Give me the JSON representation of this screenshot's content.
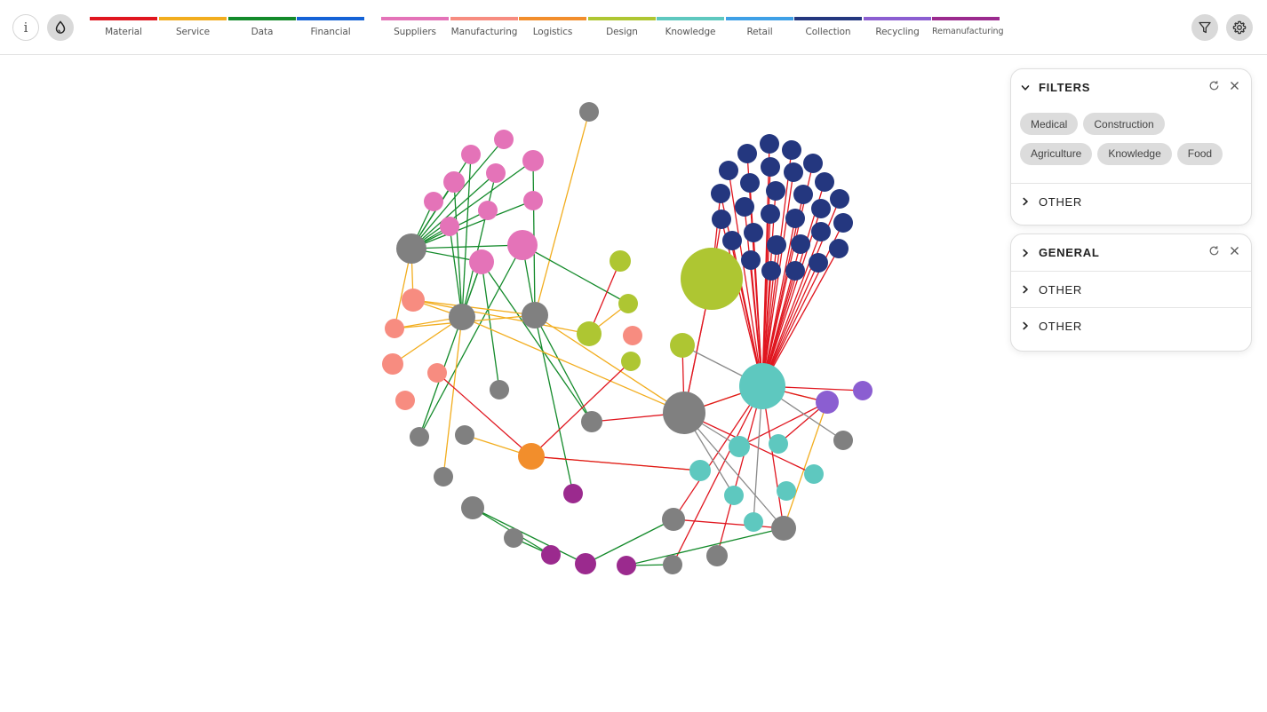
{
  "toolbar": {
    "info_label": "i"
  },
  "legend": {
    "flow_types": [
      {
        "label": "Material",
        "color": "#e0161f"
      },
      {
        "label": "Service",
        "color": "#f2ad1e"
      },
      {
        "label": "Data",
        "color": "#138a2a"
      },
      {
        "label": "Financial",
        "color": "#1462d6"
      }
    ],
    "categories": [
      {
        "label": "Suppliers",
        "color": "#e473b8"
      },
      {
        "label": "Manufacturing",
        "color": "#f78c80"
      },
      {
        "label": "Logistics",
        "color": "#f28e2c"
      },
      {
        "label": "Design",
        "color": "#aec632"
      },
      {
        "label": "Knowledge",
        "color": "#5ec8bf"
      },
      {
        "label": "Retail",
        "color": "#3ea0e6"
      },
      {
        "label": "Collection",
        "color": "#24377f"
      },
      {
        "label": "Recycling",
        "color": "#8b5ed1"
      },
      {
        "label": "Remanufacturing",
        "color": "#9b2a8e"
      }
    ]
  },
  "filters_panel": {
    "title": "FILTERS",
    "tags": [
      "Medical",
      "Construction",
      "Agriculture",
      "Knowledge",
      "Food"
    ],
    "other_label": "OTHER"
  },
  "general_panel": {
    "title": "GENERAL",
    "rows": [
      "OTHER",
      "OTHER"
    ]
  },
  "icons": {
    "info": "info-icon",
    "drop": "drop-icon",
    "filter": "filter-icon",
    "gear": "gear-icon",
    "chevron_down": "chevron-down-icon",
    "chevron_right": "chevron-right-icon",
    "refresh": "refresh-icon",
    "close": "close-icon"
  },
  "colors": {
    "neutral_node": "#808080",
    "material": "#e0161f",
    "service": "#f2ad1e",
    "data": "#138a2a",
    "link_gray": "#8a8a8a"
  }
}
